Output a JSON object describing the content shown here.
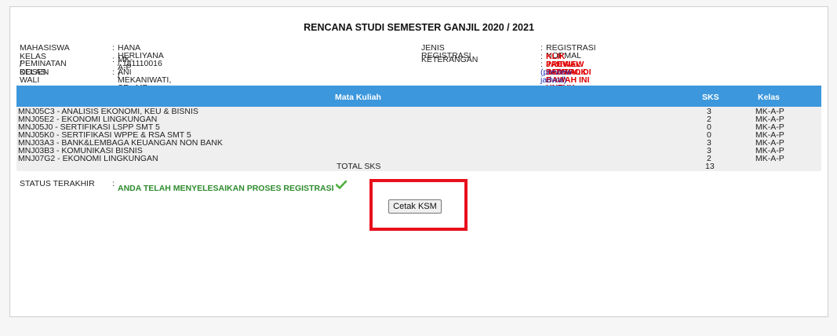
{
  "page": {
    "title": "RENCANA STUDI SEMESTER GANJIL 2020 / 2021"
  },
  "student_info": {
    "mahasiswa_label": "MAHASISWA",
    "mahasiswa_value": "HANA HERLIYANA / 181110016",
    "kelas_label_line1": "KELAS / KELAS",
    "kelas_label_line2": "PEMINATAN",
    "kelas_value": "MK-A-P /",
    "dosen_label": "DOSEN WALI",
    "dosen_value": "ANI MEKANIWATI, SE., MP.",
    "jenis_label": "JENIS REGISTRASI",
    "jenis_value": "REGISTRASI NORMAL",
    "keterangan_label": "KETERANGAN",
    "keterangan_value1": "KLIK PREVIEW JADWAL DI BAWAH INI UNTUK MENGECEK",
    "keterangan_value2": "JADWAL BENTROK",
    "preview_link": "(preview jadwal)",
    "colon": ":"
  },
  "table": {
    "headers": {
      "course": "Mata Kuliah",
      "sks": "SKS",
      "kelas": "Kelas"
    },
    "rows": [
      {
        "course": "MNJ05C3 - ANALISIS EKONOMI, KEU & BISNIS",
        "sks": "3",
        "kelas": "MK-A-P"
      },
      {
        "course": "MNJ05E2 - EKONOMI LINGKUNGAN",
        "sks": "2",
        "kelas": "MK-A-P"
      },
      {
        "course": "MNJ05J0 - SERTIFIKASI LSPP SMT 5",
        "sks": "0",
        "kelas": "MK-A-P"
      },
      {
        "course": "MNJ05K0 - SERTIFIKASI WPPE & RSA SMT 5",
        "sks": "0",
        "kelas": "MK-A-P"
      },
      {
        "course": "MNJ03A3 - BANK&LEMBAGA KEUANGAN NON BANK",
        "sks": "3",
        "kelas": "MK-A-P"
      },
      {
        "course": "MNJ03B3 - KOMUNIKASI BISNIS",
        "sks": "3",
        "kelas": "MK-A-P"
      },
      {
        "course": "MNJ07G2 - EKONOMI LINGKUNGAN",
        "sks": "2",
        "kelas": "MK-A-P"
      }
    ],
    "total_label": "TOTAL SKS",
    "total_value": "13"
  },
  "status": {
    "label": "STATUS TERAKHIR",
    "colon": ":",
    "text": "ANDA TELAH MENYELESAIKAN PROSES REGISTRASI",
    "icon": "checkmark-icon"
  },
  "actions": {
    "print_button": "Cetak KSM"
  },
  "colors": {
    "header_blue": "#3c97dc",
    "status_green": "#2e8b2e",
    "alert_red": "#e00000",
    "highlight_red": "#e8101c"
  }
}
